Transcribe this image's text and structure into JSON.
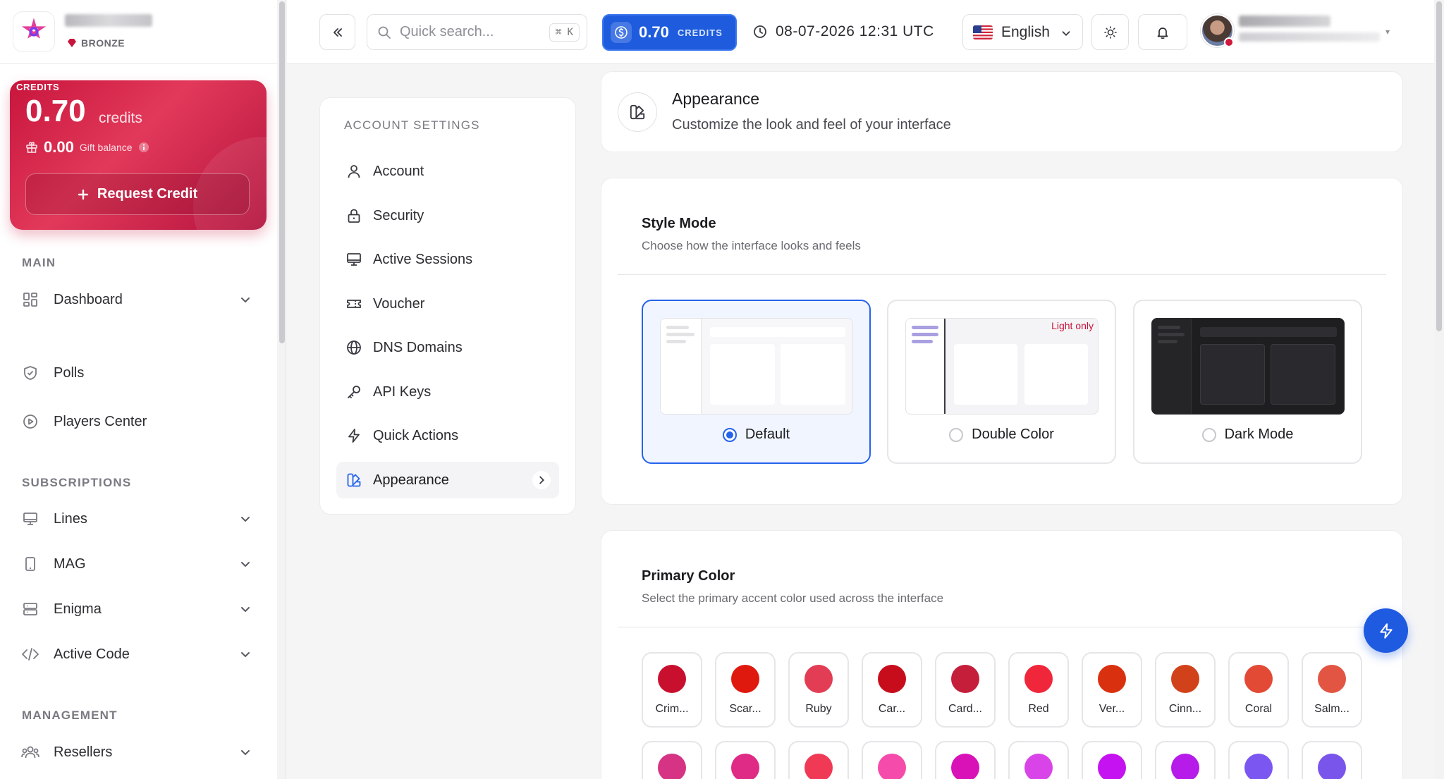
{
  "brand": {
    "tier": "BRONZE"
  },
  "credit_card": {
    "label": "CREDITS",
    "amount": "0.70",
    "unit": "credits",
    "gift_amount": "0.00",
    "gift_label": "Gift balance",
    "request_label": "Request Credit",
    "primary_color": "#c8153c"
  },
  "sidebar": {
    "sections": [
      {
        "title": "MAIN",
        "items": [
          {
            "label": "Dashboard"
          },
          {
            "label": "Polls"
          },
          {
            "label": "Players Center"
          }
        ]
      },
      {
        "title": "SUBSCRIPTIONS",
        "items": [
          {
            "label": "Lines"
          },
          {
            "label": "MAG"
          },
          {
            "label": "Enigma"
          },
          {
            "label": "Active Code"
          }
        ]
      },
      {
        "title": "MANAGEMENT",
        "items": [
          {
            "label": "Resellers"
          }
        ]
      }
    ]
  },
  "topbar": {
    "search_placeholder": "Quick search...",
    "search_shortcut": "⌘ K",
    "credits_value": "0.70",
    "credits_label": "CREDITS",
    "datetime": "08-07-2026 12:31 UTC",
    "language": "English"
  },
  "settings_menu": {
    "title": "ACCOUNT SETTINGS",
    "items": [
      {
        "label": "Account"
      },
      {
        "label": "Security"
      },
      {
        "label": "Active Sessions"
      },
      {
        "label": "Voucher"
      },
      {
        "label": "DNS Domains"
      },
      {
        "label": "API Keys"
      },
      {
        "label": "Quick Actions"
      },
      {
        "label": "Appearance"
      }
    ],
    "active": "Appearance"
  },
  "header": {
    "title": "Appearance",
    "subtitle": "Customize the look and feel of your interface"
  },
  "style_mode": {
    "title": "Style Mode",
    "subtitle": "Choose how the interface looks and feels",
    "options": [
      {
        "label": "Default",
        "selected": true
      },
      {
        "label": "Double Color",
        "selected": false,
        "badge": "Light only"
      },
      {
        "label": "Dark Mode",
        "selected": false
      }
    ]
  },
  "primary_color": {
    "title": "Primary Color",
    "subtitle": "Select the primary accent color used across the interface",
    "row1": [
      {
        "name": "Crim...",
        "color": "#c8102e"
      },
      {
        "name": "Scar...",
        "color": "#e0190f"
      },
      {
        "name": "Ruby",
        "color": "#e23d54"
      },
      {
        "name": "Car...",
        "color": "#c70d1c"
      },
      {
        "name": "Card...",
        "color": "#c41e3a"
      },
      {
        "name": "Red",
        "color": "#f0263a"
      },
      {
        "name": "Ver...",
        "color": "#d9310f"
      },
      {
        "name": "Cinn...",
        "color": "#d2421a"
      },
      {
        "name": "Coral",
        "color": "#e24a36"
      },
      {
        "name": "Salm...",
        "color": "#e25543"
      }
    ],
    "row2": [
      {
        "color": "#d63384"
      },
      {
        "color": "#df2a86"
      },
      {
        "color": "#f03a55"
      },
      {
        "color": "#f54bab"
      },
      {
        "color": "#d912b8"
      },
      {
        "color": "#d944e8"
      },
      {
        "color": "#c512f0"
      },
      {
        "color": "#b61bea"
      },
      {
        "color": "#7b56f0"
      },
      {
        "color": "#7a55ec"
      }
    ]
  }
}
